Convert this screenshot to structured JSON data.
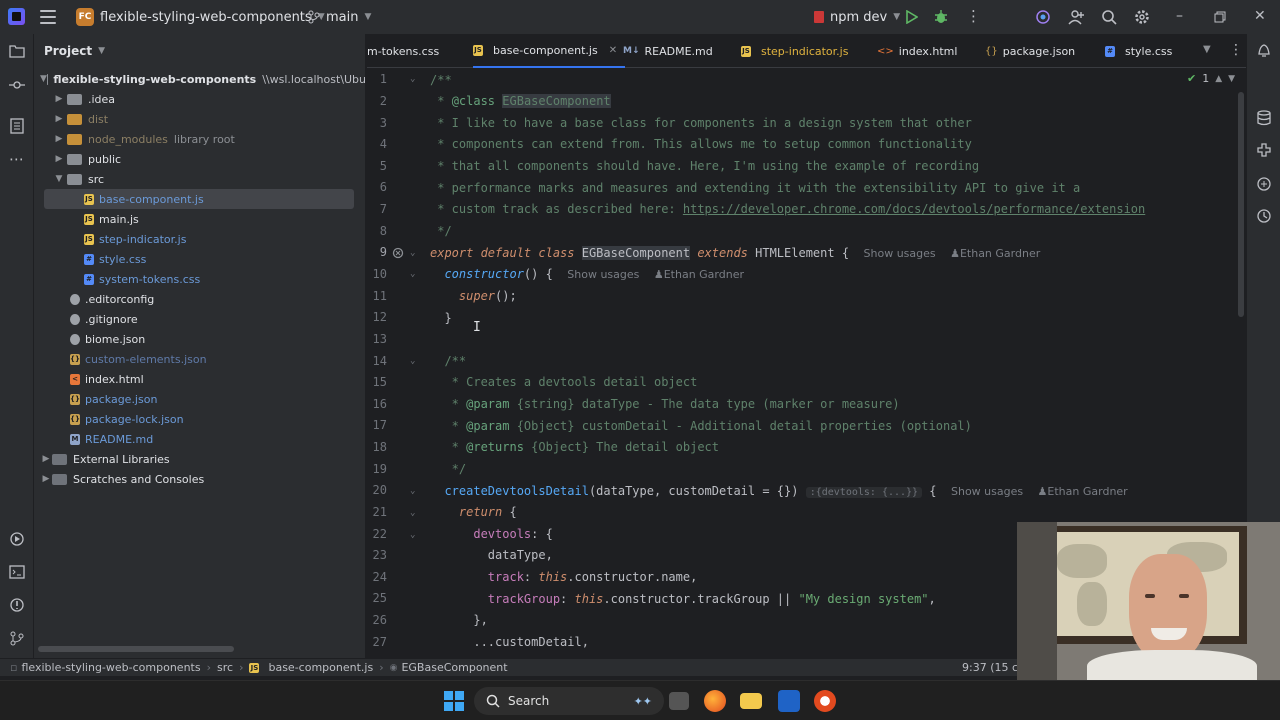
{
  "titlebar": {
    "project_badge": "FC",
    "project_name": "flexible-styling-web-components",
    "branch": "main",
    "run_config": "npm dev"
  },
  "project_panel": {
    "title": "Project",
    "root_name": "flexible-styling-web-components",
    "root_path": "\\\\wsl.localhost\\Ubu",
    "items": [
      {
        "label": ".idea"
      },
      {
        "label": "dist"
      },
      {
        "label": "node_modules",
        "sub": "library root"
      },
      {
        "label": "public"
      },
      {
        "label": "src"
      },
      {
        "label": "base-component.js"
      },
      {
        "label": "main.js"
      },
      {
        "label": "step-indicator.js"
      },
      {
        "label": "style.css"
      },
      {
        "label": "system-tokens.css"
      },
      {
        "label": ".editorconfig"
      },
      {
        "label": ".gitignore"
      },
      {
        "label": "biome.json"
      },
      {
        "label": "custom-elements.json"
      },
      {
        "label": "index.html"
      },
      {
        "label": "package.json"
      },
      {
        "label": "package-lock.json"
      },
      {
        "label": "README.md"
      },
      {
        "label": "External Libraries"
      },
      {
        "label": "Scratches and Consoles"
      }
    ]
  },
  "tabs": [
    {
      "label": "m-tokens.css"
    },
    {
      "label": "base-component.js"
    },
    {
      "label": "README.md",
      "icon_text": "M↓"
    },
    {
      "label": "step-indicator.js"
    },
    {
      "label": "index.html"
    },
    {
      "label": "package.json"
    },
    {
      "label": "style.css"
    }
  ],
  "editor": {
    "inspection_count": "1",
    "line_numbers": [
      "1",
      "2",
      "3",
      "4",
      "5",
      "6",
      "7",
      "8",
      "9",
      "10",
      "11",
      "12",
      "13",
      "14",
      "15",
      "16",
      "17",
      "18",
      "19",
      "20",
      "21",
      "22",
      "23",
      "24",
      "25",
      "26",
      "27"
    ],
    "lines": {
      "l1": "/**",
      "l2a": " * ",
      "l2b": "@class",
      "l2c": " ",
      "l2d": "EGBaseComponent",
      "l3": " * I like to have a base class for components in a design system that other",
      "l4": " * components can extend from. This allows me to setup common functionality",
      "l5": " * that all components should have. Here, I'm using the example of recording",
      "l6": " * performance marks and measures and extending it with the extensibility API to give it a",
      "l7a": " * custom track as described here: ",
      "l7b": "https://developer.chrome.com/docs/devtools/performance/extension",
      "l8": " */",
      "l9a": "export default class ",
      "l9b": "EGBaseComponent",
      "l9c": " extends ",
      "l9d": "HTMLElement",
      "l9e": " {",
      "l10a": "  constructor",
      "l10b": "() {",
      "l11a": "    super",
      "l11b": "();",
      "l12": "  }",
      "l14": "  /**",
      "l15": "   * Creates a devtools detail object",
      "l16a": "   * ",
      "l16b": "@param",
      "l16c": " {string} dataType",
      "l16d": " - The data type (marker or measure)",
      "l17a": "   * ",
      "l17b": "@param",
      "l17c": " {Object} customDetail",
      "l17d": " - Additional detail properties (optional)",
      "l18a": "   * ",
      "l18b": "@returns",
      "l18c": " {Object}",
      "l18d": " The detail object",
      "l19": "   */",
      "l20a": "  createDevtoolsDetail",
      "l20b": "(dataType, customDetail = {})",
      "l20c": ":{devtools: {...}}",
      "l20d": " {",
      "l21a": "    return",
      "l21b": " {",
      "l22a": "      devtools",
      "l22b": ": {",
      "l23": "        dataType,",
      "l24a": "        track",
      "l24b": ": ",
      "l24c": "this",
      "l24d": ".constructor.name,",
      "l25a": "        trackGroup",
      "l25b": ": ",
      "l25c": "this",
      "l25d": ".constructor.trackGroup || ",
      "l25e": "\"My design system\"",
      "l25f": ",",
      "l26": "      },",
      "l27": "      ...customDetail,"
    },
    "hints": {
      "show_usages": "Show usages",
      "author": "Ethan Gardner"
    }
  },
  "statusbar": {
    "crumbs": [
      "flexible-styling-web-components",
      "src",
      "base-component.js",
      "EGBaseComponent"
    ],
    "position": "9:37 (15 ch"
  },
  "taskbar": {
    "search_label": "Search"
  }
}
